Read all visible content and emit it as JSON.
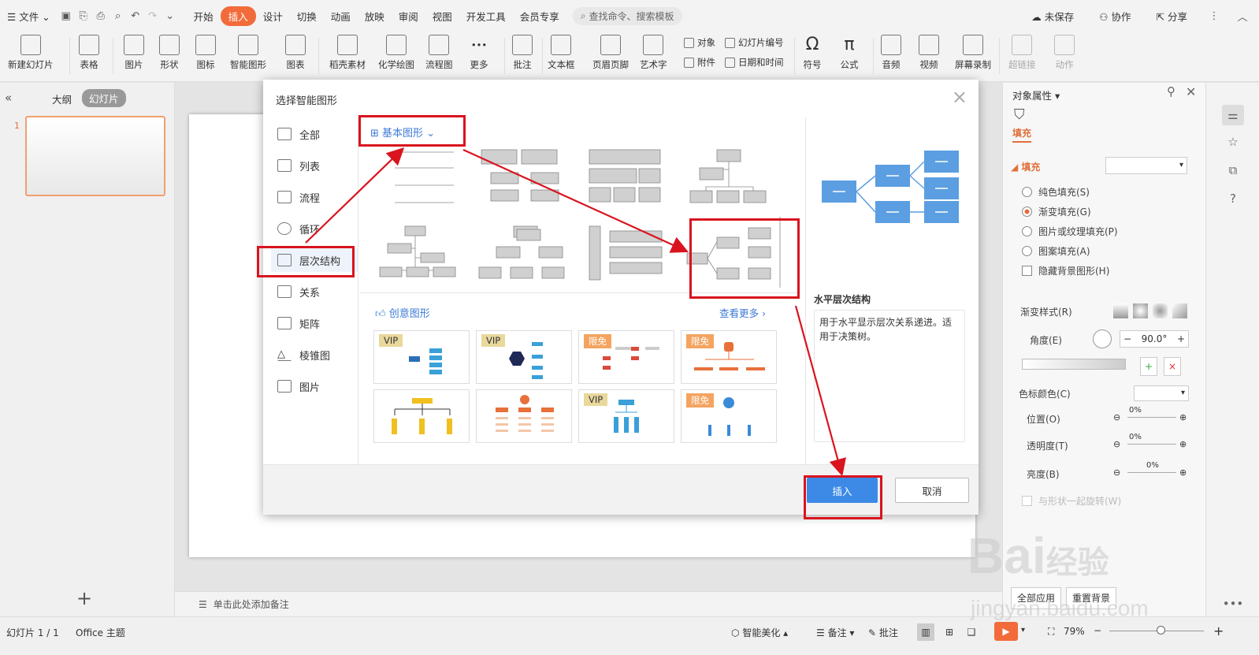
{
  "menubar": {
    "file": "文件",
    "tabs": [
      "开始",
      "插入",
      "设计",
      "切换",
      "动画",
      "放映",
      "审阅",
      "视图",
      "开发工具",
      "会员专享"
    ],
    "active_tab_index": 1,
    "search_placeholder": "查找命令、搜索模板",
    "right": [
      "未保存",
      "协作",
      "分享"
    ]
  },
  "ribbon": {
    "big": [
      "新建幻灯片",
      "表格",
      "图片",
      "形状",
      "图标",
      "智能图形",
      "图表",
      "稻壳素材",
      "化学绘图",
      "流程图",
      "更多",
      "批注",
      "文本框",
      "页眉页脚",
      "艺术字",
      "符号",
      "公式",
      "音频",
      "视频",
      "屏幕录制",
      "超链接",
      "动作"
    ],
    "small": [
      "对象",
      "幻灯片编号",
      "附件",
      "日期和时间"
    ]
  },
  "left_pane": {
    "tab_outline": "大纲",
    "tab_slides": "幻灯片",
    "slide_number": "1",
    "add": "+"
  },
  "notes": {
    "placeholder": "单击此处添加备注"
  },
  "dialog": {
    "title": "选择智能图形",
    "categories": [
      "全部",
      "列表",
      "流程",
      "循环",
      "层次结构",
      "关系",
      "矩阵",
      "棱锥图",
      "图片"
    ],
    "selected_category_index": 4,
    "basic_label": "基本图形",
    "creative_label": "创意图形",
    "see_more": "查看更多",
    "badges": [
      "VIP",
      "VIP",
      "限免",
      "限免",
      "",
      "",
      "VIP",
      "限免"
    ],
    "preview_title": "水平层次结构",
    "preview_desc": "用于水平显示层次关系递进。适用于决策树。",
    "insert": "插入",
    "cancel": "取消"
  },
  "props": {
    "header": "对象属性",
    "tab_fill": "填充",
    "section_fill": "填充",
    "options": [
      "纯色填充(S)",
      "渐变填充(G)",
      "图片或纹理填充(P)",
      "图案填充(A)"
    ],
    "selected_option_index": 1,
    "hide_bg": "隐藏背景图形(H)",
    "gradient_style": "渐变样式(R)",
    "angle_label": "角度(E)",
    "angle_value": "90.0°",
    "stop_color": "色标颜色(C)",
    "position": "位置(O)",
    "transparency": "透明度(T)",
    "brightness": "亮度(B)",
    "pct": "0%",
    "rotate_with": "与形状一起旋转(W)",
    "apply_all": "全部应用",
    "reset": "重置背景"
  },
  "status": {
    "slide_info": "幻灯片 1 / 1",
    "theme": "Office 主题",
    "smart_beautify": "智能美化",
    "notes": "备注",
    "comments": "批注",
    "zoom": "79%"
  },
  "watermark": {
    "brand": "Bai",
    "cn": "经验",
    "url": "jingyan.baidu.com"
  },
  "colors": {
    "accent": "#f26b3a",
    "insert_btn": "#3d8ae6",
    "annotation": "#d9141e",
    "shape_blue": "#5b9ee1"
  }
}
